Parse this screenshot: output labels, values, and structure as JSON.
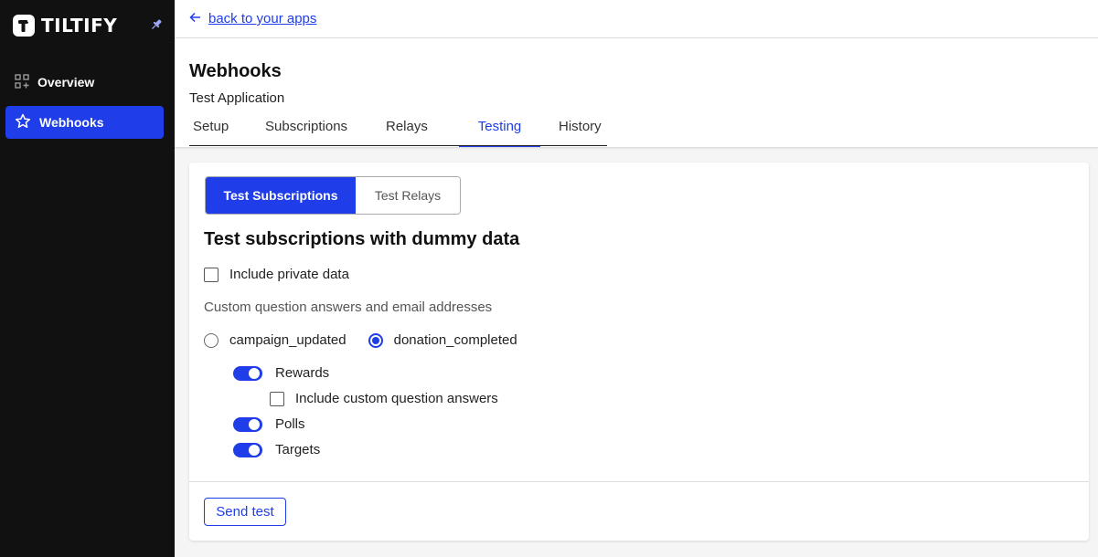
{
  "sidebar": {
    "brand": "TILTIFY",
    "pin_icon": "pin-icon",
    "items": [
      {
        "label": "Overview",
        "icon": "grid-plus-icon",
        "active": false
      },
      {
        "label": "Webhooks",
        "icon": "star-icon",
        "active": true
      }
    ]
  },
  "topbar": {
    "back_label": "back to your apps",
    "back_icon": "arrow-left-icon"
  },
  "header": {
    "title": "Webhooks",
    "subtitle": "Test Application",
    "tabs": [
      {
        "label": "Setup",
        "active": false
      },
      {
        "label": "Subscriptions",
        "active": false
      },
      {
        "label": "Relays",
        "active": false
      },
      {
        "label": "Testing",
        "active": true
      },
      {
        "label": "History",
        "active": false
      }
    ]
  },
  "card": {
    "segments": [
      {
        "label": "Test Subscriptions",
        "active": true
      },
      {
        "label": "Test Relays",
        "active": false
      }
    ],
    "section_title": "Test subscriptions with dummy data",
    "include_private": {
      "label": "Include private data",
      "checked": false
    },
    "custom_note": "Custom question answers and email addresses",
    "event_types": [
      {
        "label": "campaign_updated",
        "selected": false
      },
      {
        "label": "donation_completed",
        "selected": true
      }
    ],
    "options": {
      "rewards": {
        "label": "Rewards",
        "on": true
      },
      "include_custom": {
        "label": "Include custom question answers",
        "checked": false
      },
      "polls": {
        "label": "Polls",
        "on": true
      },
      "targets": {
        "label": "Targets",
        "on": true
      }
    },
    "send_label": "Send test"
  },
  "colors": {
    "accent": "#1f3de8",
    "sidebar_bg": "#111111",
    "page_bg": "#f5f5f5"
  }
}
